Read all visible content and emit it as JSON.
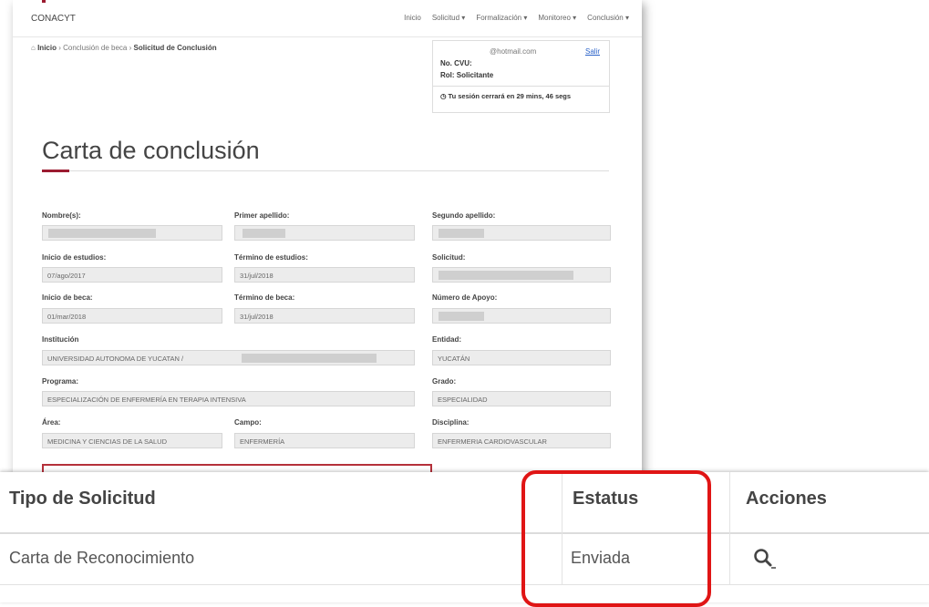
{
  "header": {
    "brand": "CONACYT",
    "nav": [
      "Inicio",
      "Solicitud ▾",
      "Formalización ▾",
      "Monitoreo ▾",
      "Conclusión ▾"
    ]
  },
  "breadcrumb": {
    "home": "Inicio",
    "middle": "Conclusión de beca",
    "current": "Solicitud de Conclusión",
    "sep": "›"
  },
  "session": {
    "email": "@hotmail.com",
    "logout": "Salir",
    "cvu_label": "No. CVU:",
    "rol": "Rol: Solicitante",
    "timer": "Tu sesión cerrará en 29 mins, 46 segs"
  },
  "page_title": "Carta de conclusión",
  "form": {
    "nombre_label": "Nombre(s):",
    "primer_label": "Primer apellido:",
    "segundo_label": "Segundo apellido:",
    "inicio_estudios_label": "Inicio de estudios:",
    "inicio_estudios": "07/ago/2017",
    "termino_estudios_label": "Término de estudios:",
    "termino_estudios": "31/jul/2018",
    "solicitud_label": "Solicitud:",
    "inicio_beca_label": "Inicio de beca:",
    "inicio_beca": "01/mar/2018",
    "termino_beca_label": "Término de beca:",
    "termino_beca": "31/jul/2018",
    "numero_apoyo_label": "Número de Apoyo:",
    "institucion_label": "Institución",
    "institucion": "UNIVERSIDAD AUTONOMA DE YUCATAN /",
    "entidad_label": "Entidad:",
    "entidad": "YUCATÁN",
    "programa_label": "Programa:",
    "programa": "ESPECIALIZACIÓN DE ENFERMERÍA EN TERAPIA INTENSIVA",
    "grado_label": "Grado:",
    "grado": "ESPECIALIDAD",
    "area_label": "Área:",
    "area": "MEDICINA Y CIENCIAS DE LA SALUD",
    "campo_label": "Campo:",
    "campo": "ENFERMERÍA",
    "disciplina_label": "Disciplina:",
    "disciplina": "ENFERMERIA CARDIOVASCULAR"
  },
  "table": {
    "headers": [
      "Tipo de Solicitud",
      "Estatus",
      "Acciones"
    ],
    "rows": [
      {
        "tipo": "Carta de Reconocimiento",
        "estatus": "Enviada",
        "accion_icon": "search-icon"
      }
    ]
  },
  "colors": {
    "accent": "#9b1b30",
    "highlight": "#e01515",
    "link": "#2a62c9"
  }
}
